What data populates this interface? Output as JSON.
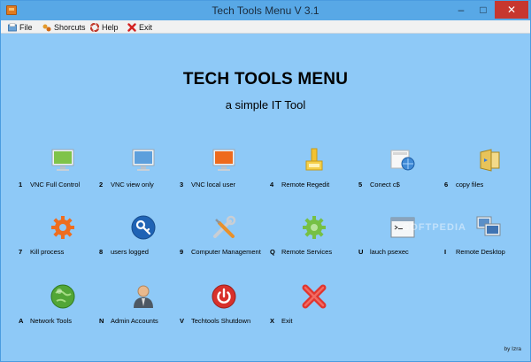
{
  "window": {
    "title": "Tech Tools Menu V 3.1",
    "buttons": {
      "minimize": "–",
      "maximize": "□",
      "close": "✕"
    }
  },
  "menu": [
    {
      "label": "File",
      "icon": "folder-icon"
    },
    {
      "label": "Shorcuts",
      "icon": "shortcut-icon"
    },
    {
      "label": "Help",
      "icon": "help-icon"
    },
    {
      "label": "Exit",
      "icon": "exit-x-icon"
    }
  ],
  "main": {
    "heading": "TECH TOOLS MENU",
    "subheading": "a simple IT Tool"
  },
  "tools": [
    {
      "key": "1",
      "label": "VNC Full Control",
      "icon": "monitor-green-icon"
    },
    {
      "key": "2",
      "label": "VNC view only",
      "icon": "monitor-blue-icon"
    },
    {
      "key": "3",
      "label": "VNC local user",
      "icon": "monitor-orange-icon"
    },
    {
      "key": "4",
      "label": "Remote Regedit",
      "icon": "registry-icon"
    },
    {
      "key": "5",
      "label": "Conect c$",
      "icon": "network-folder-icon"
    },
    {
      "key": "6",
      "label": "copy files",
      "icon": "copy-files-icon"
    },
    {
      "key": "7",
      "label": "Kill process",
      "icon": "gear-orange-icon"
    },
    {
      "key": "8",
      "label": "users logged",
      "icon": "key-icon"
    },
    {
      "key": "9",
      "label": "Computer Management",
      "icon": "tools-icon"
    },
    {
      "key": "Q",
      "label": "Remote Services",
      "icon": "gear-green-icon"
    },
    {
      "key": "U",
      "label": "lauch psexec",
      "icon": "console-icon"
    },
    {
      "key": "I",
      "label": "Remote Desktop",
      "icon": "remote-desktop-icon"
    },
    {
      "key": "A",
      "label": "Network Tools",
      "icon": "globe-icon"
    },
    {
      "key": "N",
      "label": "Admin  Accounts",
      "icon": "admin-user-icon"
    },
    {
      "key": "V",
      "label": "Techtools Shutdown",
      "icon": "power-icon"
    },
    {
      "key": "X",
      "label": "Exit",
      "icon": "red-x-icon"
    }
  ],
  "footer": {
    "credit": "by Izra"
  },
  "watermark": "SOFTPEDIA"
}
